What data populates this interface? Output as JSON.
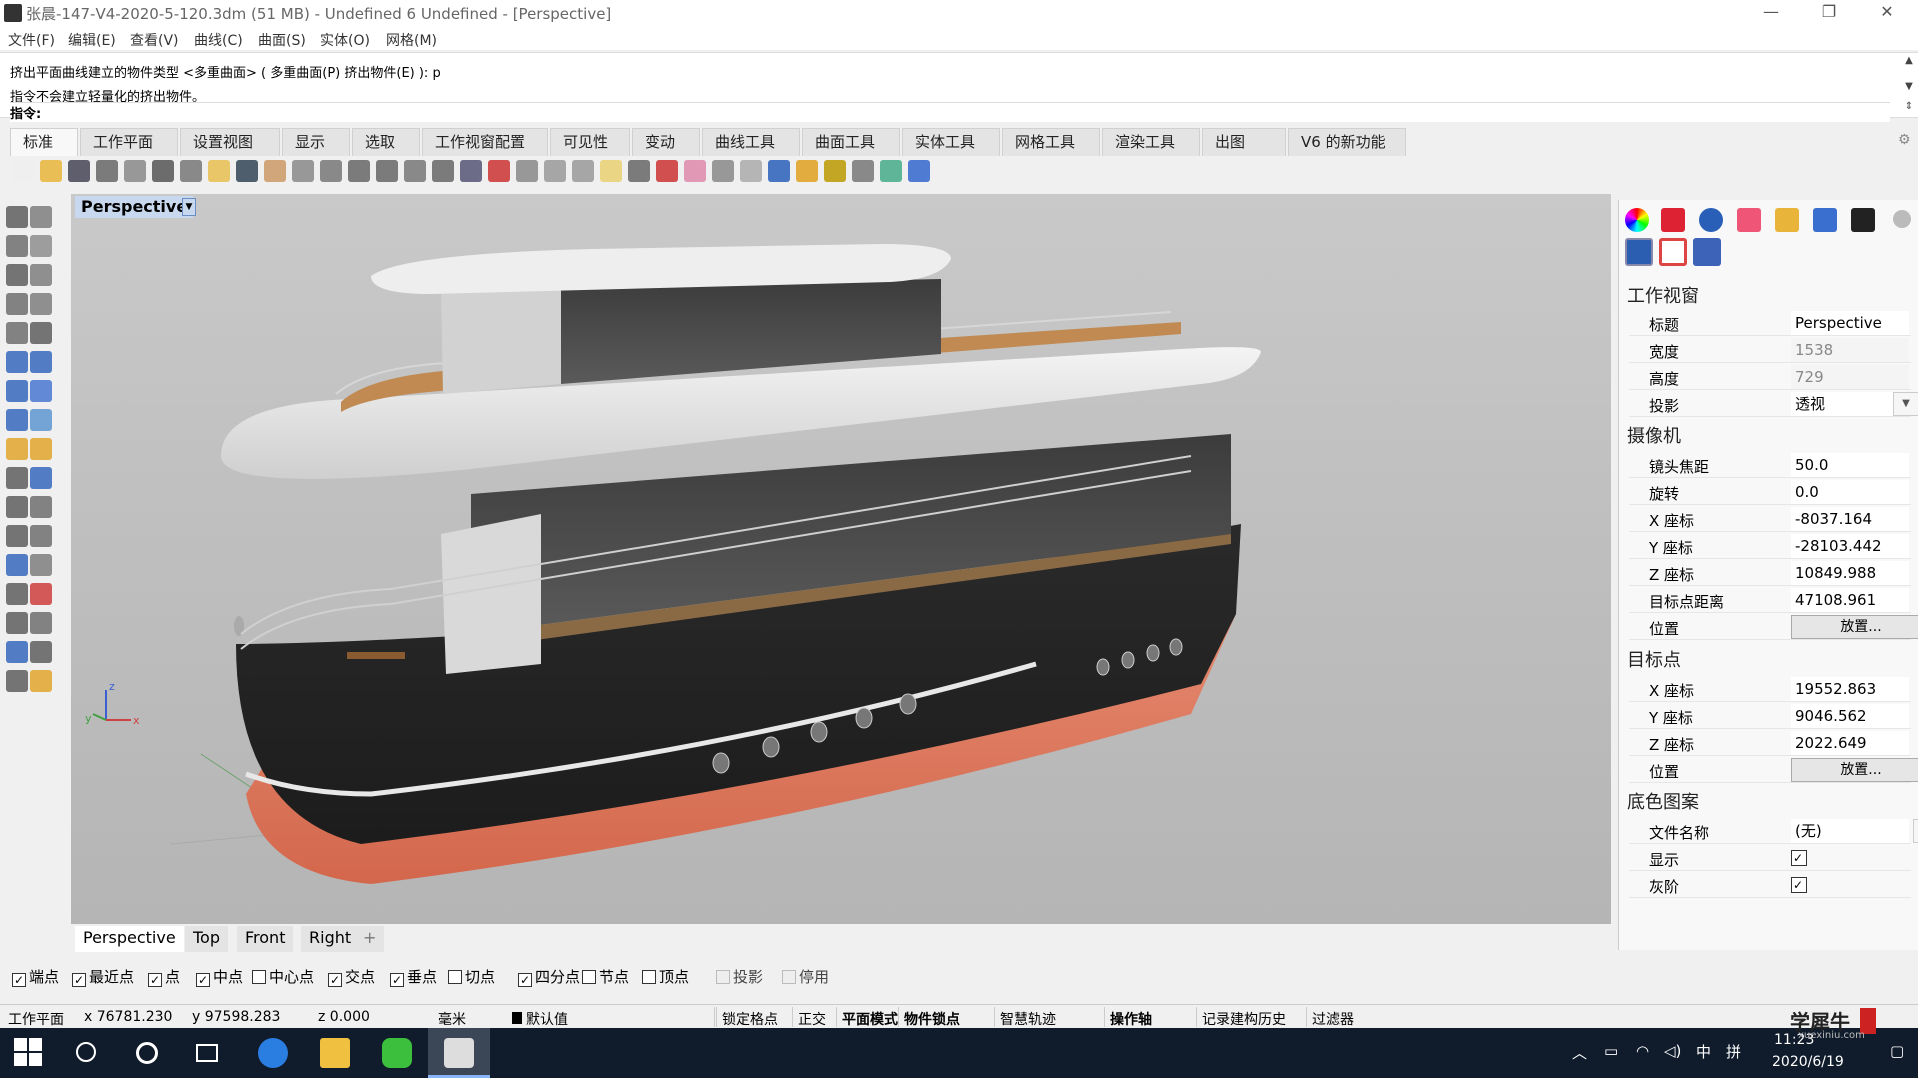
{
  "window": {
    "title": "张晨-147-V4-2020-5-120.3dm (51 MB) - Undefined 6 Undefined - [Perspective]",
    "controls": [
      "—",
      "❐",
      "✕"
    ]
  },
  "menu": [
    "文件(F)",
    "编辑(E)",
    "查看(V)",
    "曲线(C)",
    "曲面(S)",
    "实体(O)",
    "网格(M)"
  ],
  "command": {
    "line1": "挤出平面曲线建立的物件类型 <多重曲面> ( 多重曲面(P)  挤出物件(E) ): p",
    "line2": "指令不会建立轻量化的挤出物件。",
    "prompt": "指令:"
  },
  "toolbar_tabs": [
    "标准",
    "工作平面",
    "设置视图",
    "显示",
    "选取",
    "工作视窗配置",
    "可见性",
    "变动",
    "曲线工具",
    "曲面工具",
    "实体工具",
    "网格工具",
    "渲染工具",
    "出图",
    "V6 的新功能"
  ],
  "toolbar_icons": [
    "new-icon",
    "open-icon",
    "save-icon",
    "print-icon",
    "import-icon",
    "cut-icon",
    "copy-icon",
    "paste-icon",
    "undo-icon",
    "pan-hand-icon",
    "move-icon",
    "zoom-icon",
    "zoom-window-icon",
    "zoom-extents-icon",
    "zoom-selected-icon",
    "rotate-view-icon",
    "four-views-icon",
    "car-icon",
    "grid-snap-icon",
    "ellipse-icon",
    "point-cloud-icon",
    "light-icon",
    "lock-icon",
    "layer-icon",
    "color-wheel-icon",
    "material-sphere-icon",
    "render-sphere-icon",
    "render-blue-icon",
    "tag-icon",
    "gear-group-icon",
    "dimension-icon",
    "globe-icon",
    "help-icon"
  ],
  "viewport": {
    "label": "Perspective",
    "tabs": [
      "Perspective",
      "Top",
      "Front",
      "Right"
    ],
    "add_tab": "+",
    "axis": {
      "x": "x",
      "y": "y",
      "z": "z"
    }
  },
  "snaps": [
    {
      "label": "端点",
      "checked": true
    },
    {
      "label": "最近点",
      "checked": true
    },
    {
      "label": "点",
      "checked": true
    },
    {
      "label": "中点",
      "checked": true
    },
    {
      "label": "中心点",
      "checked": false
    },
    {
      "label": "交点",
      "checked": true
    },
    {
      "label": "垂点",
      "checked": true
    },
    {
      "label": "切点",
      "checked": false
    },
    {
      "label": "四分点",
      "checked": true
    },
    {
      "label": "节点",
      "checked": false
    },
    {
      "label": "顶点",
      "checked": false
    },
    {
      "label": "投影",
      "checked": false
    },
    {
      "label": "停用",
      "checked": false
    }
  ],
  "status": {
    "cplane": "工作平面",
    "x": "x 76781.230",
    "y": "y 97598.283",
    "z": "z 0.000",
    "unit": "毫米",
    "layer": "默认值",
    "items": [
      "锁定格点",
      "正交",
      "平面模式",
      "物件锁点",
      "智慧轨迹",
      "操作轴",
      "记录建构历史",
      "过滤器"
    ],
    "bold": [
      false,
      false,
      true,
      true,
      false,
      true,
      false,
      false
    ]
  },
  "panel": {
    "viewport_section": "工作视窗",
    "rows_vp": [
      {
        "k": "标题",
        "v": "Perspective"
      },
      {
        "k": "宽度",
        "v": "1538"
      },
      {
        "k": "高度",
        "v": "729"
      },
      {
        "k": "投影",
        "v": "透视"
      }
    ],
    "camera_section": "摄像机",
    "rows_cam": [
      {
        "k": "镜头焦距",
        "v": "50.0"
      },
      {
        "k": "旋转",
        "v": "0.0"
      },
      {
        "k": "X 座标",
        "v": "-8037.164"
      },
      {
        "k": "Y 座标",
        "v": "-28103.442"
      },
      {
        "k": "Z 座标",
        "v": "10849.988"
      },
      {
        "k": "目标点距离",
        "v": "47108.961"
      },
      {
        "k": "位置",
        "v": "放置..."
      }
    ],
    "target_section": "目标点",
    "rows_tgt": [
      {
        "k": "X 座标",
        "v": "19552.863"
      },
      {
        "k": "Y 座标",
        "v": "9046.562"
      },
      {
        "k": "Z 座标",
        "v": "2022.649"
      },
      {
        "k": "位置",
        "v": "放置..."
      }
    ],
    "wallpaper_section": "底色图案",
    "rows_wp": [
      {
        "k": "文件名称",
        "v": "(无)"
      },
      {
        "k": "显示",
        "v": "✓"
      },
      {
        "k": "灰阶",
        "v": "✓"
      }
    ],
    "browse": "..."
  },
  "taskbar": {
    "time": "11:23",
    "date": "2020/6/19",
    "ime": "中",
    "ime2": "拼",
    "watermark": "学犀牛",
    "watermark_url": "xuexiniu.com"
  }
}
